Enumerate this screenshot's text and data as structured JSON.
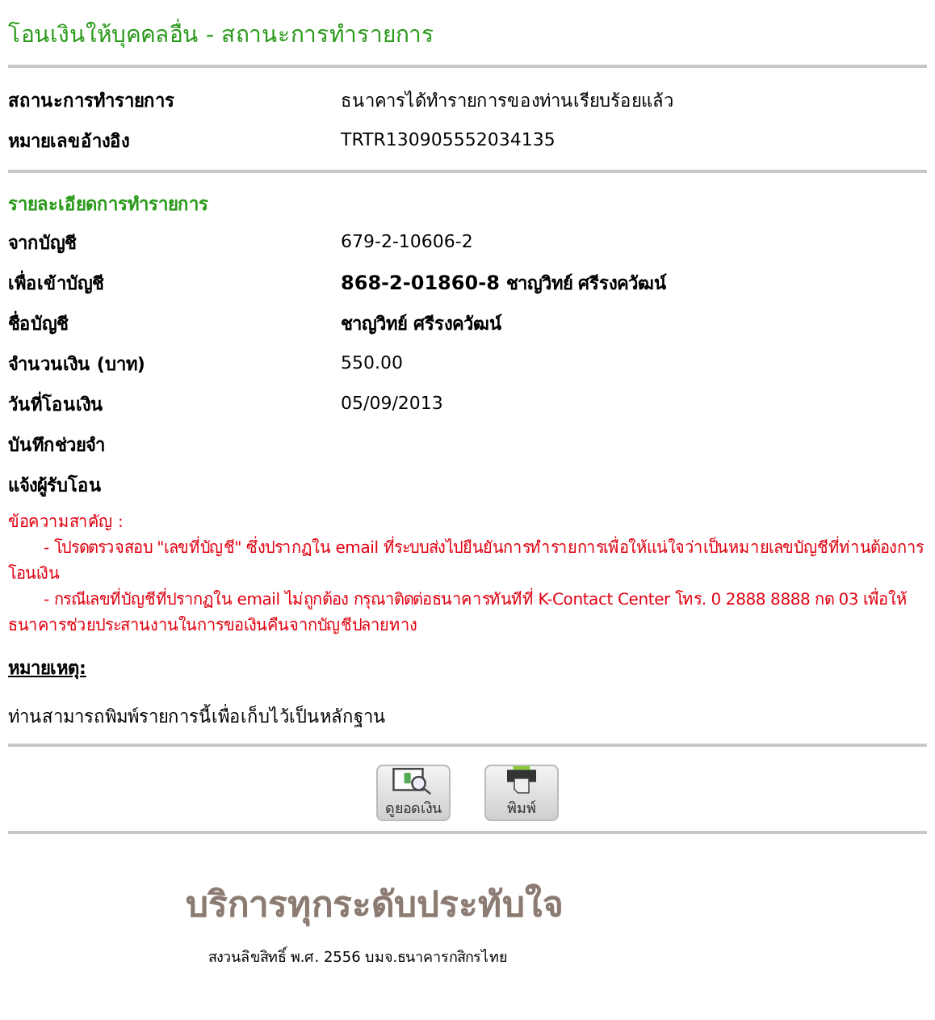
{
  "title": "โอนเงินให้บุคคลอื่น - สถานะการทำรายการ",
  "status_rows": [
    {
      "label": "สถานะการทำรายการ",
      "value": "ธนาคารได้ทำรายการของท่านเรียบร้อยแล้ว"
    },
    {
      "label": "หมายเลขอ้างอิง",
      "value": "TRTR130905552034135"
    }
  ],
  "details": {
    "heading": "รายละเอียดการทำรายการ",
    "rows": [
      {
        "label": "จากบัญชี",
        "value": "679-2-10606-2",
        "kind": "plain"
      },
      {
        "label": "เพื่อเข้าบัญชี",
        "value": "**868-2-01860-8** ชาญวิทย์ ศรีรงควัฒน์",
        "kind": "bold"
      },
      {
        "label": "ชื่อบัญชี",
        "value": "ชาญวิทย์ ศรีรงควัฒน์",
        "kind": "bold"
      },
      {
        "label": "จำนวนเงิน (บาท)",
        "value": "550.00",
        "kind": "plain"
      },
      {
        "label": "วันที่โอนเงิน",
        "value": "05/09/2013",
        "kind": "plain"
      },
      {
        "label": "บันทึกช่วยจำ",
        "kind": "plain"
      },
      {
        "label": "แจ้งผู้รับโอน",
        "kind": "plain"
      }
    ]
  },
  "important": {
    "heading": "ข้อความสาคัญ :",
    "items": [
      "- โปรดตรวจสอบ \"เลขที่บัญชี\" ซึ่งปรากฏใน email ที่ระบบส่งไปยืนยันการทำรายการเพื่อให้แน่ใจว่าเป็นหมายเลขบัญชีที่ท่านต้องการโอนเงิน",
      "- กรณีเลขที่บัญชีที่ปรากฏใน email ไม่ถูกต้อง กรุณาติดต่อธนาคารทันทีที่ K-Contact Center โทร. 0 2888 8888 กด 03 เพื่อให้ธนาคารช่วยประสานงานในการขอเงินคืนจากบัญชีปลายทาง"
    ]
  },
  "note": {
    "heading": "หมายเหตุ:",
    "text": "ท่านสามารถพิมพ์รายการนี้เพื่อเก็บไว้เป็นหลักฐาน"
  },
  "buttons": [
    {
      "label": "ดูยอดเงิน",
      "kind": "balance"
    },
    {
      "label": "พิมพ์",
      "kind": "print"
    }
  ],
  "footer": {
    "slogan": "บริการทุกระดับประทับใจ",
    "copyright": "สงวนลิขสิทธิ์ พ.ศ. 2556 บมจ.ธนาคารกสิกรไทย"
  }
}
